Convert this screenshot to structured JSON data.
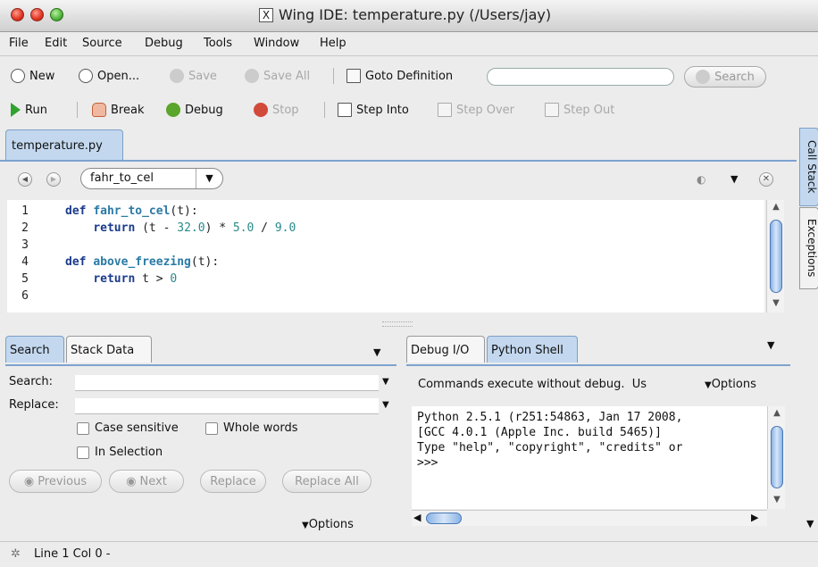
{
  "window": {
    "title": "Wing IDE: temperature.py (/Users/jay)"
  },
  "menu": [
    "File",
    "Edit",
    "Source",
    "Debug",
    "Tools",
    "Window",
    "Help"
  ],
  "toolbar1": {
    "new": "New",
    "open": "Open...",
    "save": "Save",
    "save_all": "Save All",
    "goto": "Goto Definition",
    "goto_value": "",
    "search": "Search"
  },
  "toolbar2": {
    "run": "Run",
    "break": "Break",
    "debug": "Debug",
    "stop": "Stop",
    "step_into": "Step Into",
    "step_over": "Step Over",
    "step_out": "Step Out"
  },
  "editor": {
    "tab": "temperature.py",
    "function_selected": "fahr_to_cel",
    "line_numbers": [
      "1",
      "2",
      "3",
      "4",
      "5",
      "6"
    ]
  },
  "side_tabs": [
    "Call Stack",
    "Exceptions"
  ],
  "search_panel": {
    "tabs": [
      "Search",
      "Stack Data"
    ],
    "search_label": "Search:",
    "replace_label": "Replace:",
    "case_sensitive": "Case sensitive",
    "whole_words": "Whole words",
    "in_selection": "In Selection",
    "previous": "Previous",
    "next": "Next",
    "replace": "Replace",
    "replace_all": "Replace All",
    "options": "Options"
  },
  "shell_panel": {
    "tabs": [
      "Debug I/O",
      "Python Shell"
    ],
    "info": "Commands execute without debug.  Us",
    "options": "Options",
    "output": "Python 2.5.1 (r251:54863, Jan 17 2008,\n[GCC 4.0.1 (Apple Inc. build 5465)]\nType \"help\", \"copyright\", \"credits\" or\n>>>"
  },
  "status": {
    "text": "Line 1 Col 0 -"
  },
  "colors": {
    "accent": "#7da2cf",
    "tab_active": "#c3d8ef",
    "keyword": "#1a3b8c",
    "number": "#2a8a8a"
  }
}
